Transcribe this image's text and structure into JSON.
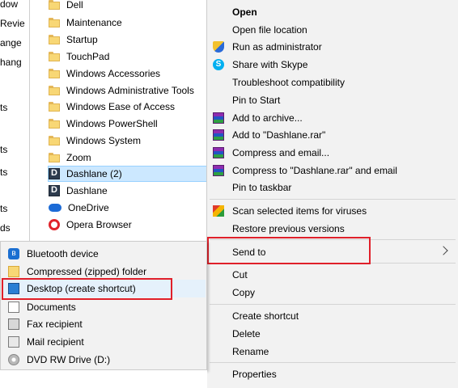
{
  "left_fragments": [
    "dow",
    "Revie",
    "ange",
    "hang",
    "ts",
    "ts",
    "ts",
    "ts",
    "ds"
  ],
  "explorer": {
    "items": [
      {
        "label": "Dell",
        "icon": "folder-icon"
      },
      {
        "label": "Maintenance",
        "icon": "folder-icon"
      },
      {
        "label": "Startup",
        "icon": "folder-icon"
      },
      {
        "label": "TouchPad",
        "icon": "folder-icon"
      },
      {
        "label": "Windows Accessories",
        "icon": "folder-icon"
      },
      {
        "label": "Windows Administrative Tools",
        "icon": "folder-icon"
      },
      {
        "label": "Windows Ease of Access",
        "icon": "folder-icon"
      },
      {
        "label": "Windows PowerShell",
        "icon": "folder-icon"
      },
      {
        "label": "Windows System",
        "icon": "folder-icon"
      },
      {
        "label": "Zoom",
        "icon": "folder-icon"
      },
      {
        "label": "Dashlane (2)",
        "icon": "dashlane-icon",
        "selected": true
      },
      {
        "label": "Dashlane",
        "icon": "dashlane-icon"
      },
      {
        "label": "OneDrive",
        "icon": "onedrive-icon"
      },
      {
        "label": "Opera Browser",
        "icon": "opera-icon"
      }
    ]
  },
  "context_menu": {
    "items": [
      {
        "label": "Open",
        "bold": true
      },
      {
        "label": "Open file location"
      },
      {
        "label": "Run as administrator",
        "icon": "shield-icon"
      },
      {
        "label": "Share with Skype",
        "icon": "skype-icon"
      },
      {
        "label": "Troubleshoot compatibility"
      },
      {
        "label": "Pin to Start"
      },
      {
        "label": "Add to archive...",
        "icon": "winrar-icon"
      },
      {
        "label": "Add to \"Dashlane.rar\"",
        "icon": "winrar-icon"
      },
      {
        "label": "Compress and email...",
        "icon": "winrar-icon"
      },
      {
        "label": "Compress to \"Dashlane.rar\" and email",
        "icon": "winrar-icon"
      },
      {
        "label": "Pin to taskbar"
      },
      {
        "label": "Scan selected items for viruses",
        "icon": "antivirus-icon"
      },
      {
        "label": "Restore previous versions"
      },
      {
        "label": "Send to",
        "has_submenu": true,
        "highlighted": true
      },
      {
        "label": "Cut"
      },
      {
        "label": "Copy"
      },
      {
        "label": "Create shortcut"
      },
      {
        "label": "Delete"
      },
      {
        "label": "Rename"
      },
      {
        "label": "Properties"
      }
    ]
  },
  "send_to_menu": {
    "items": [
      {
        "label": "Bluetooth device",
        "icon": "bluetooth-icon"
      },
      {
        "label": "Compressed (zipped) folder",
        "icon": "zip-folder-icon"
      },
      {
        "label": "Desktop (create shortcut)",
        "icon": "desktop-icon",
        "highlighted": true
      },
      {
        "label": "Documents",
        "icon": "documents-icon"
      },
      {
        "label": "Fax recipient",
        "icon": "fax-icon"
      },
      {
        "label": "Mail recipient",
        "icon": "mail-icon"
      },
      {
        "label": "DVD RW Drive (D:)",
        "icon": "dvd-drive-icon"
      }
    ]
  },
  "colors": {
    "highlight_box": "#e0202a",
    "selection": "#cce8ff",
    "menu_background": "#f2f2f2"
  }
}
